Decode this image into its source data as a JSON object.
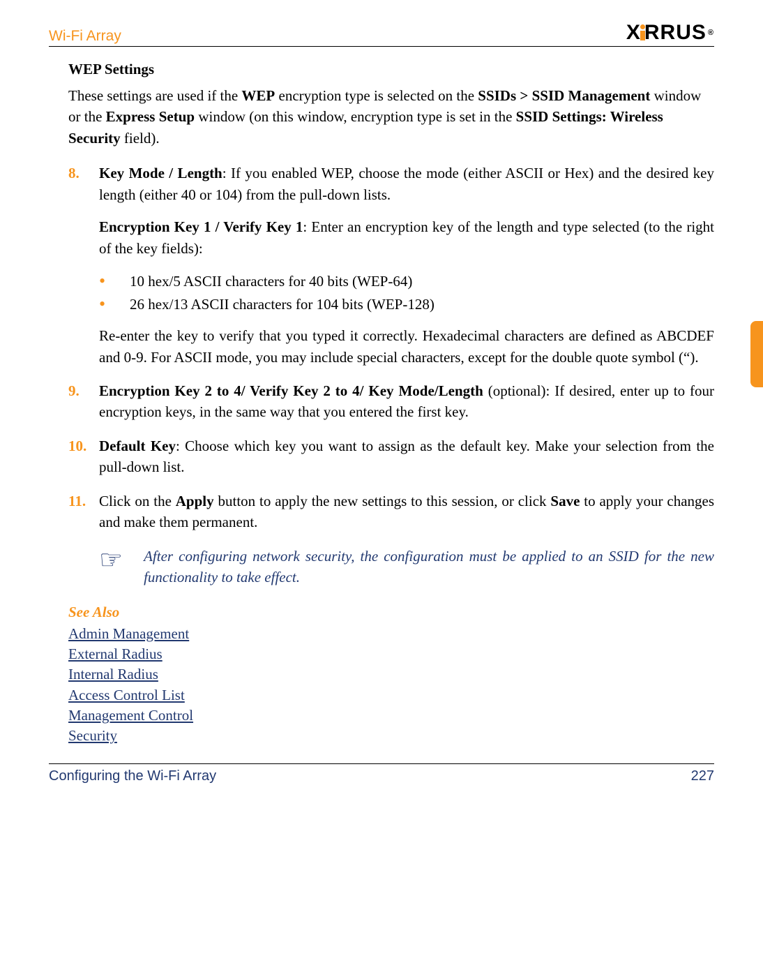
{
  "header": {
    "title": "Wi-Fi Array",
    "brand": "XIRRUS"
  },
  "section": {
    "heading": "WEP Settings",
    "intro_parts": {
      "p1": "These settings are used if the ",
      "b1": "WEP",
      "p2": " encryption type is selected on the ",
      "b2": "SSIDs > SSID Management",
      "p3": " window or the ",
      "b3": "Express Setup",
      "p4": " window (on this window, encryption type is set in the ",
      "b4": "SSID Settings: Wireless Security",
      "p5": " field)."
    }
  },
  "items": {
    "n8": "8.",
    "i8": {
      "b1": "Key Mode / Length",
      "t1": ": If you enabled WEP, choose the mode (either ASCII or Hex) and the desired key length (either 40 or 104) from the pull-down lists.",
      "b2": "Encryption Key 1 / Verify Key 1",
      "t2": ": Enter an encryption key of the length and type selected (to the right of the key fields):",
      "bul1": "10 hex/5 ASCII characters for 40 bits (WEP-64)",
      "bul2": "26 hex/13 ASCII characters for 104 bits (WEP-128)",
      "t3": "Re-enter the key to verify that you typed it correctly. Hexadecimal characters are defined as ABCDEF and 0-9. For ASCII mode, you may include special characters, except for the double quote symbol (“)."
    },
    "n9": "9.",
    "i9": {
      "b1": "Encryption Key 2 to 4/ Verify Key 2 to 4/ Key Mode/Length",
      "t1": " (optional): If desired, enter up to four encryption keys, in the same way that you entered the first key."
    },
    "n10": "10.",
    "i10": {
      "b1": "Default Key",
      "t1": ": Choose which key you want to assign as the default key. Make your selection from the pull-down list."
    },
    "n11": "11.",
    "i11": {
      "t1": "Click on the ",
      "b1": "Apply",
      "t2": " button to apply the new settings to this session, or click ",
      "b2": "Save",
      "t3": " to apply your changes and make them permanent."
    }
  },
  "note": "After configuring network security, the configuration must be applied to an SSID for the new functionality to take effect.",
  "see_also": {
    "heading": "See Also",
    "links": [
      "Admin Management",
      "External Radius",
      "Internal Radius",
      "Access Control List",
      "Management Control",
      "Security"
    ]
  },
  "footer": {
    "left": "Configuring the Wi-Fi Array",
    "page": "227"
  }
}
